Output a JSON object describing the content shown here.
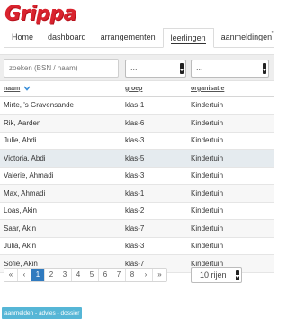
{
  "header": {
    "logo_text": "Grippa"
  },
  "nav": {
    "items": [
      "Home",
      "dashboard",
      "arrangementen",
      "leerlingen",
      "aanmeldingen"
    ],
    "active": "leerlingen",
    "overflow": "•"
  },
  "filters": {
    "search_placeholder": "zoeken (BSN / naam)",
    "select1_value": "...",
    "select2_value": "..."
  },
  "table": {
    "columns": [
      "naam",
      "groep",
      "organisatie"
    ],
    "rows": [
      [
        "Mirte, 's Gravensande",
        "klas-1",
        "Kindertuin"
      ],
      [
        "Rik, Aarden",
        "klas-6",
        "Kindertuin"
      ],
      [
        "Julie, Abdi",
        "klas-3",
        "Kindertuin"
      ],
      [
        "Victoria, Abdi",
        "klas-5",
        "Kindertuin"
      ],
      [
        "Valerie, Ahmadi",
        "klas-3",
        "Kindertuin"
      ],
      [
        "Max, Ahmadi",
        "klas-1",
        "Kindertuin"
      ],
      [
        "Loas, Akin",
        "klas-2",
        "Kindertuin"
      ],
      [
        "Saar, Akin",
        "klas-7",
        "Kindertuin"
      ],
      [
        "Julia, Akin",
        "klas-3",
        "Kindertuin"
      ],
      [
        "Sofie, Akin",
        "klas-7",
        "Kindertuin"
      ]
    ]
  },
  "pagination": {
    "first": "«",
    "prev": "‹",
    "pages": [
      "1",
      "2",
      "3",
      "4",
      "5",
      "6",
      "7",
      "8"
    ],
    "active_page": "1",
    "next": "›",
    "last": "»",
    "rows_per_page": "10 rijen"
  },
  "footer": {
    "button_label": "aanmelden - advies - dossier"
  },
  "colors": {
    "brand": "#d9232e",
    "accent": "#2f7abf",
    "footer_button": "#56b6d6",
    "highlight_row": "#e5ebef"
  }
}
